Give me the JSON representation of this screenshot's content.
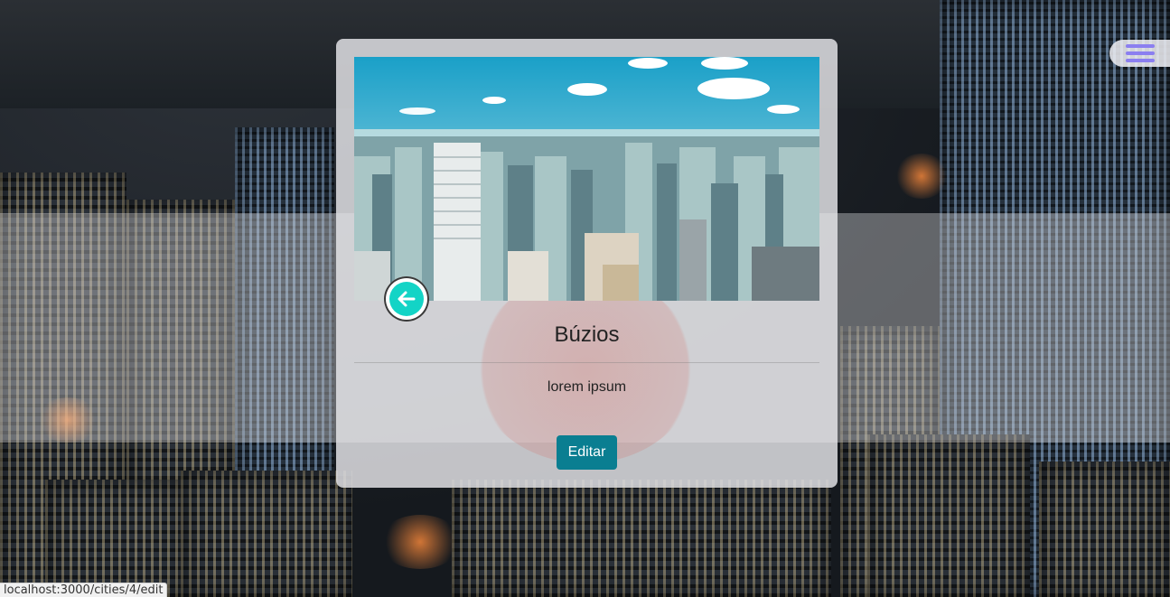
{
  "background": {
    "theme": "night-city-skyline",
    "band_color": "#e1e2e6"
  },
  "nav": {
    "menu_icon": "hamburger-menu-icon",
    "menu_color": "#8b7ff0"
  },
  "card": {
    "image_alt": "city skyline photo",
    "back_icon": "arrow-left-icon",
    "back_color": "#13d4c6",
    "title": "Búzios",
    "description": "lorem ipsum",
    "edit_label": "Editar",
    "edit_color": "#0a7e91"
  },
  "status_bar": {
    "url": "localhost:3000/cities/4/edit"
  }
}
